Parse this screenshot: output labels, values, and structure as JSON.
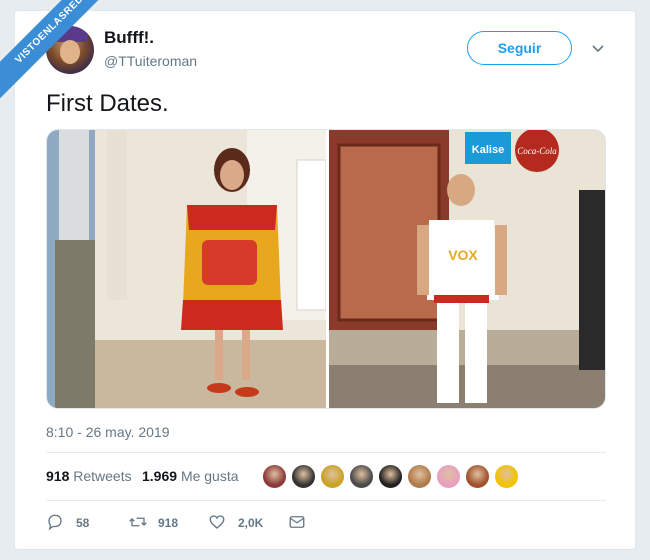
{
  "watermark": "VISTOENLASREDES",
  "author": {
    "display_name": "Bufff!.",
    "handle": "@TTuiteroman"
  },
  "follow_label": "Seguir",
  "tweet_text": "First Dates.",
  "media": {
    "left_photo": "photo-woman-flag-dress",
    "right_photo": "photo-man-vox-shirt",
    "right_sign_1": "Kalise",
    "right_sign_2": "Coca-Cola",
    "shirt_text": "VOX"
  },
  "timestamp": "8:10 - 26 may. 2019",
  "stats": {
    "retweets_count": "918",
    "retweets_label": "Retweets",
    "likes_count": "1.969",
    "likes_label": "Me gusta"
  },
  "liker_avatar_colors": [
    "#8b3a3a",
    "#333333",
    "#c9a227",
    "#4a4a4a",
    "#222222",
    "#b07b4a",
    "#e8a0c0",
    "#a0522d",
    "#f2c200"
  ],
  "actions": {
    "reply_count": "58",
    "retweet_count": "918",
    "like_count": "2,0K"
  },
  "colors": {
    "accent": "#1da1f2",
    "text": "#14171a",
    "muted": "#657786"
  }
}
